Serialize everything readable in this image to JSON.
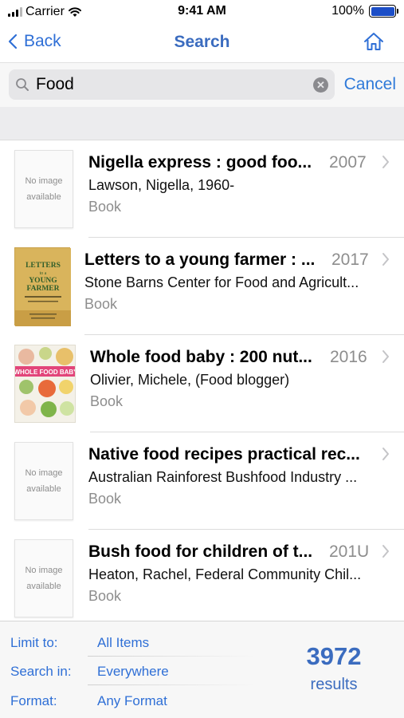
{
  "status_bar": {
    "carrier": "Carrier",
    "time": "9:41 AM",
    "battery": "100%"
  },
  "nav": {
    "back_label": "Back",
    "title": "Search",
    "home_icon": "home-icon"
  },
  "search": {
    "query": "Food",
    "cancel_label": "Cancel"
  },
  "results": [
    {
      "title": "Nigella express : good foo...",
      "year": "2007",
      "author": "Lawson, Nigella, 1960-",
      "type": "Book",
      "cover": "no-image",
      "cover_text": [
        "No image",
        "available"
      ]
    },
    {
      "title": "Letters to a young farmer : ...",
      "year": "2017",
      "author": "Stone Barns Center for Food and Agricult...",
      "type": "Book",
      "cover": "letters-young-farmer",
      "cover_text": [
        "LETTERS",
        "to a",
        "YOUNG",
        "FARMER"
      ]
    },
    {
      "title": "Whole food baby : 200 nut...",
      "year": "2016",
      "author": "Olivier, Michele, (Food blogger)",
      "type": "Book",
      "cover": "whole-food-baby",
      "cover_text": [
        "WHOLE FOOD BABY"
      ]
    },
    {
      "title": "Native food recipes practical rec...",
      "year": "",
      "author": "Australian Rainforest Bushfood Industry ...",
      "type": "Book",
      "cover": "no-image",
      "cover_text": [
        "No image",
        "available"
      ]
    },
    {
      "title": "Bush food for children of t...",
      "year": "201U",
      "author": "Heaton, Rachel, Federal Community Chil...",
      "type": "Book",
      "cover": "no-image",
      "cover_text": [
        "No image",
        "available"
      ]
    }
  ],
  "footer": {
    "limit_label": "Limit to:",
    "limit_value": "All Items",
    "search_in_label": "Search in:",
    "search_in_value": "Everywhere",
    "format_label": "Format:",
    "format_value": "Any Format",
    "result_count": "3972",
    "result_label": "results"
  },
  "colors": {
    "accent": "#2f6fd6",
    "title_blue": "#3b6cbf",
    "secondary_text": "#8d8d8d"
  }
}
